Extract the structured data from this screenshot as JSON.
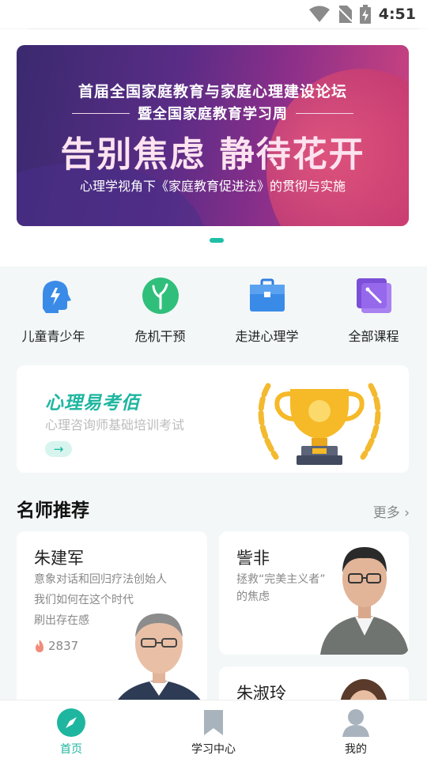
{
  "status": {
    "time": "4:51"
  },
  "banner": {
    "line1": "首届全国家庭教育与家庭心理建设论坛",
    "line2": "暨全国家庭教育学习周",
    "headline": "告别焦虑 静待花开",
    "line4": "心理学视角下《家庭教育促进法》的贯彻与实施"
  },
  "categories": [
    {
      "label": "儿童青少年",
      "icon": "child-head-icon"
    },
    {
      "label": "危机干预",
      "icon": "sprout-icon"
    },
    {
      "label": "走进心理学",
      "icon": "briefcase-icon"
    },
    {
      "label": "全部课程",
      "icon": "all-courses-icon"
    }
  ],
  "exam": {
    "title": "心理易考佰",
    "subtitle": "心理咨询师基础培训考试",
    "arrow": "→"
  },
  "section": {
    "title": "名师推荐",
    "more": "更多"
  },
  "teachers": [
    {
      "name": "朱建军",
      "desc1": "意象对话和回归疗法创始人",
      "desc2": "我们如何在这个时代",
      "desc3": "刷出存在感",
      "views": "2837"
    },
    {
      "name": "訾非",
      "desc1": "拯救“完美主义者”",
      "desc2": "的焦虑"
    },
    {
      "name": "朱淑玲"
    }
  ],
  "nav": [
    {
      "label": "首页",
      "active": true
    },
    {
      "label": "学习中心",
      "active": false
    },
    {
      "label": "我的",
      "active": false
    }
  ],
  "colors": {
    "accent": "#1fb6a0",
    "banner_start": "#3a2a6f",
    "banner_end": "#d2457e"
  }
}
